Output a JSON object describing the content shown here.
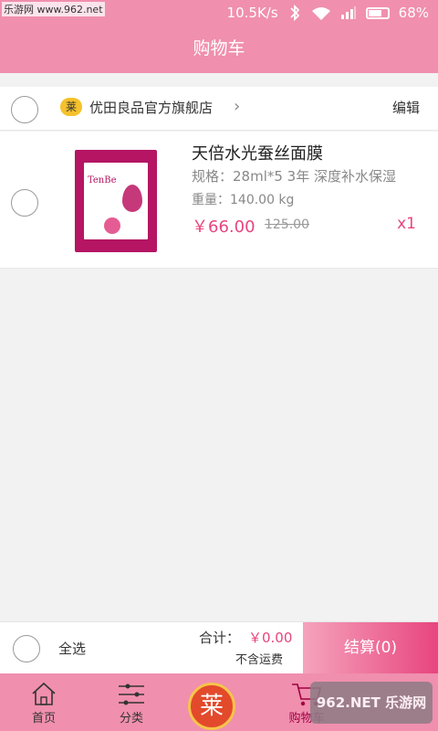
{
  "status_bar": {
    "watermark": "乐游网 www.962.net",
    "speed": "10.5K/s",
    "battery": "68%"
  },
  "header": {
    "title": "购物车"
  },
  "shop": {
    "badge": "莱",
    "name": "优田良品官方旗舰店",
    "edit_label": "编辑"
  },
  "item": {
    "image_brand": "TenBe",
    "title": "天倍水光蚕丝面膜",
    "spec": "规格：28ml*5 3年  深度补水保湿",
    "weight": "重量：140.00 kg",
    "price": "￥66.00",
    "original_price": "125.00",
    "quantity": "x1"
  },
  "checkout_bar": {
    "select_all_label": "全选",
    "total_label": "合计：",
    "total_value": "￥0.00",
    "shipping_note": "不含运费",
    "checkout_label": "结算(0)"
  },
  "tabbar": {
    "tabs": [
      {
        "label": "首页",
        "icon": "home-icon"
      },
      {
        "label": "分类",
        "icon": "category-icon"
      },
      {
        "label": "购物车",
        "icon": "cart-icon",
        "active": true
      }
    ],
    "center_logo": "莱",
    "watermark": "962.NET 乐游网"
  },
  "colors": {
    "accent": "#f08fae",
    "price": "#e8457e"
  }
}
